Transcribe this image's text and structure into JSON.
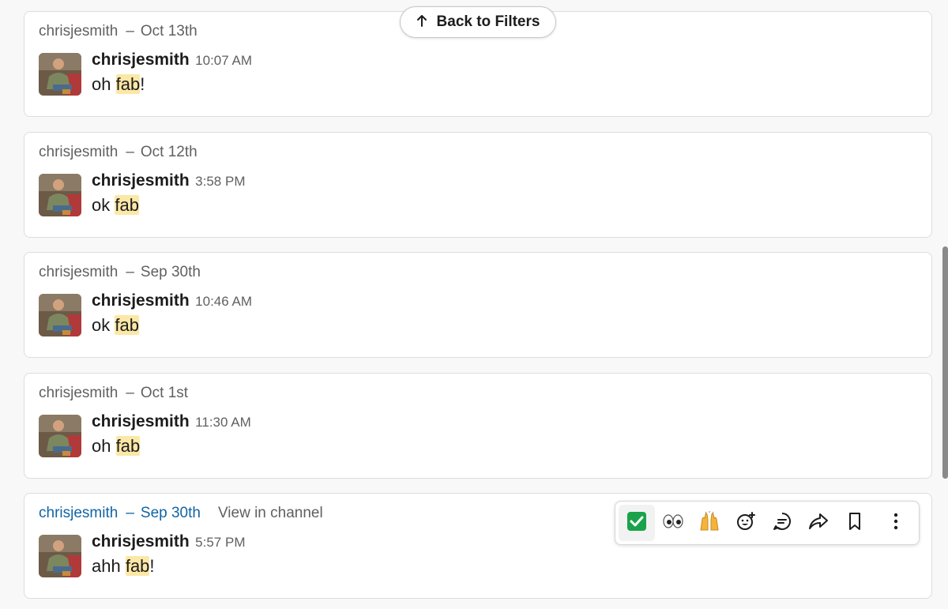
{
  "back_button": {
    "label": "Back to Filters"
  },
  "messages": [
    {
      "header_name": "chrisjesmith",
      "header_sep": "–",
      "header_date": "Oct 13th",
      "author": "chrisjesmith",
      "time": "10:07 AM",
      "pre": "oh ",
      "match": "fab",
      "post": "!"
    },
    {
      "header_name": "chrisjesmith",
      "header_sep": "–",
      "header_date": "Oct 12th",
      "author": "chrisjesmith",
      "time": "3:58 PM",
      "pre": "ok ",
      "match": "fab",
      "post": ""
    },
    {
      "header_name": "chrisjesmith",
      "header_sep": "–",
      "header_date": "Sep 30th",
      "author": "chrisjesmith",
      "time": "10:46 AM",
      "pre": "ok ",
      "match": "fab",
      "post": ""
    },
    {
      "header_name": "chrisjesmith",
      "header_sep": "–",
      "header_date": "Oct 1st",
      "author": "chrisjesmith",
      "time": "11:30 AM",
      "pre": "oh ",
      "match": "fab",
      "post": ""
    },
    {
      "header_name": "chrisjesmith",
      "header_sep": "–",
      "header_date": "Sep 30th",
      "view_in_channel": "View in channel",
      "author": "chrisjesmith",
      "time": "5:57 PM",
      "pre": "ahh ",
      "match": "fab",
      "post": "!"
    }
  ],
  "toolbar": {
    "items": [
      {
        "icon": "check-mark-emoji-icon"
      },
      {
        "icon": "eyes-emoji-icon"
      },
      {
        "icon": "raised-hands-emoji-icon"
      },
      {
        "icon": "add-reaction-icon"
      },
      {
        "icon": "reply-in-thread-icon"
      },
      {
        "icon": "share-arrow-icon"
      },
      {
        "icon": "bookmark-icon"
      },
      {
        "icon": "more-actions-icon"
      }
    ]
  },
  "colors": {
    "highlight": "#fbe8a6",
    "link": "#1264a3",
    "check_green": "#1aa34a"
  }
}
